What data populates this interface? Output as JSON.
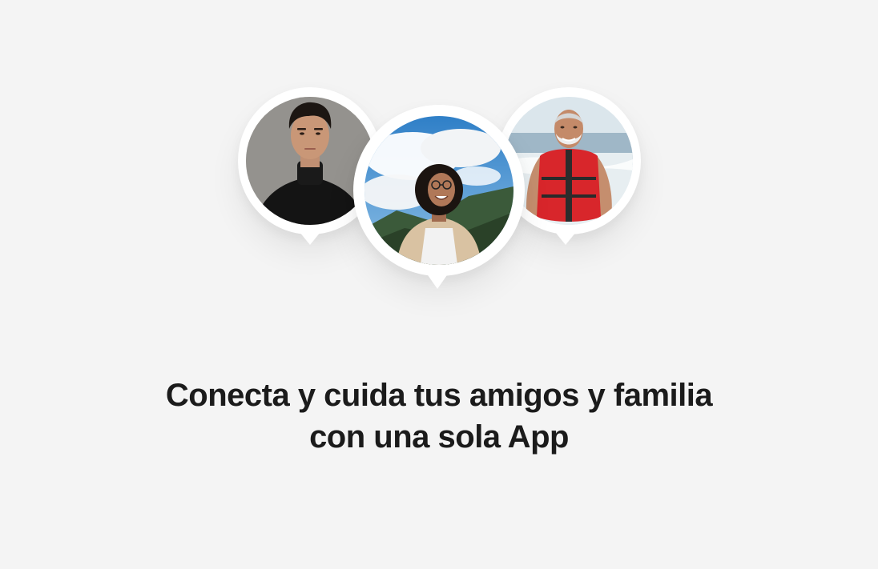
{
  "hero": {
    "headline_line1": "Conecta y cuida tus amigos y familia",
    "headline_line2": "con una sola App"
  },
  "avatars": [
    {
      "name": "person-young-man-turtleneck",
      "accent": "#1a1a1a"
    },
    {
      "name": "person-woman-mountains",
      "accent": "#3a86c8"
    },
    {
      "name": "person-older-man-lifejacket",
      "accent": "#d8262b"
    }
  ],
  "colors": {
    "background": "#f4f4f4",
    "text": "#1b1b1b",
    "pin": "#ffffff"
  }
}
